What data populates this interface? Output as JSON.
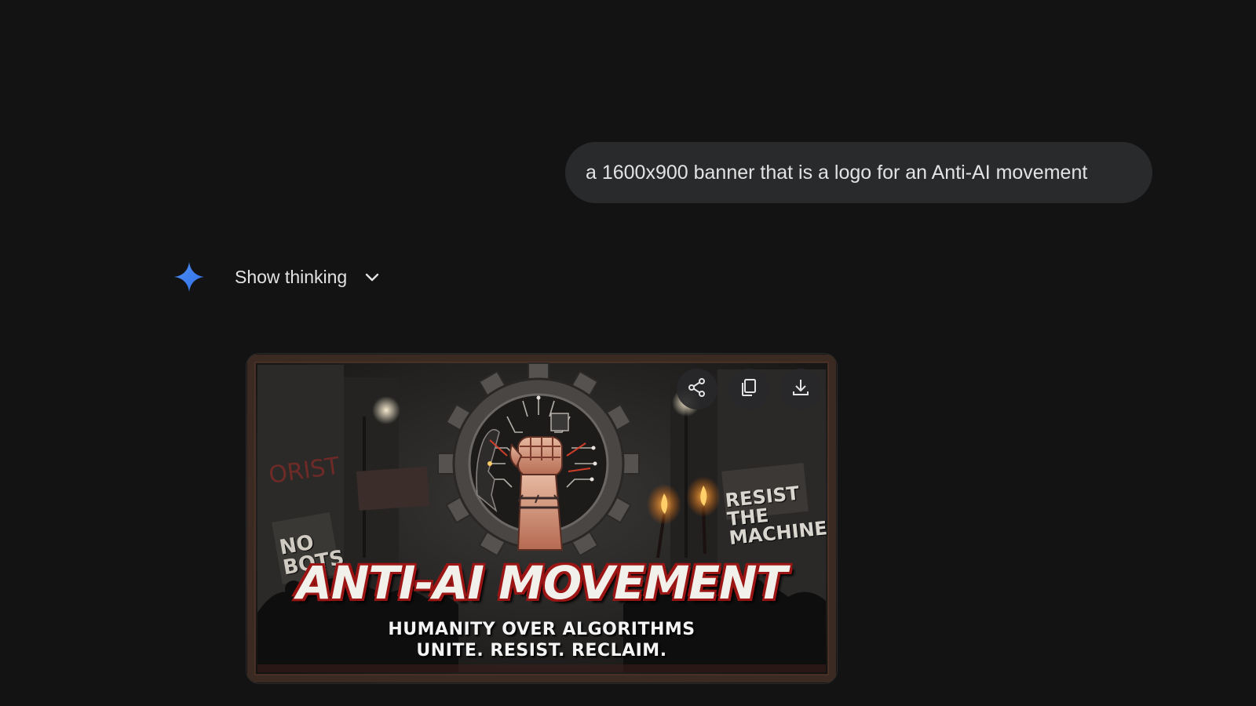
{
  "conversation": {
    "user_message": "a 1600x900 banner that is a logo for an Anti-AI movement",
    "assistant": {
      "icon": "gemini-spark-icon",
      "show_thinking_label": "Show thinking",
      "chevron_icon": "chevron-down-icon"
    }
  },
  "generated_image": {
    "title": "ANTI-AI MOVEMENT",
    "subtitle_line1": "HUMANITY OVER ALGORITHMS",
    "subtitle_line2": "UNITE. RESIST. RECLAIM.",
    "sign_right_line1": "RESIST THE",
    "sign_right_line2": "MACHINE",
    "sign_left_line1": "NO",
    "sign_left_line2": "BOTS",
    "actions": [
      {
        "icon": "share-icon",
        "label": "Share"
      },
      {
        "icon": "copy-icon",
        "label": "Copy"
      },
      {
        "icon": "download-icon",
        "label": "Download"
      }
    ]
  },
  "colors": {
    "background": "#131314",
    "bubble": "#282a2c",
    "text": "#e3e3e3",
    "spark": "#4285f4",
    "title_outline": "#9b1515"
  }
}
